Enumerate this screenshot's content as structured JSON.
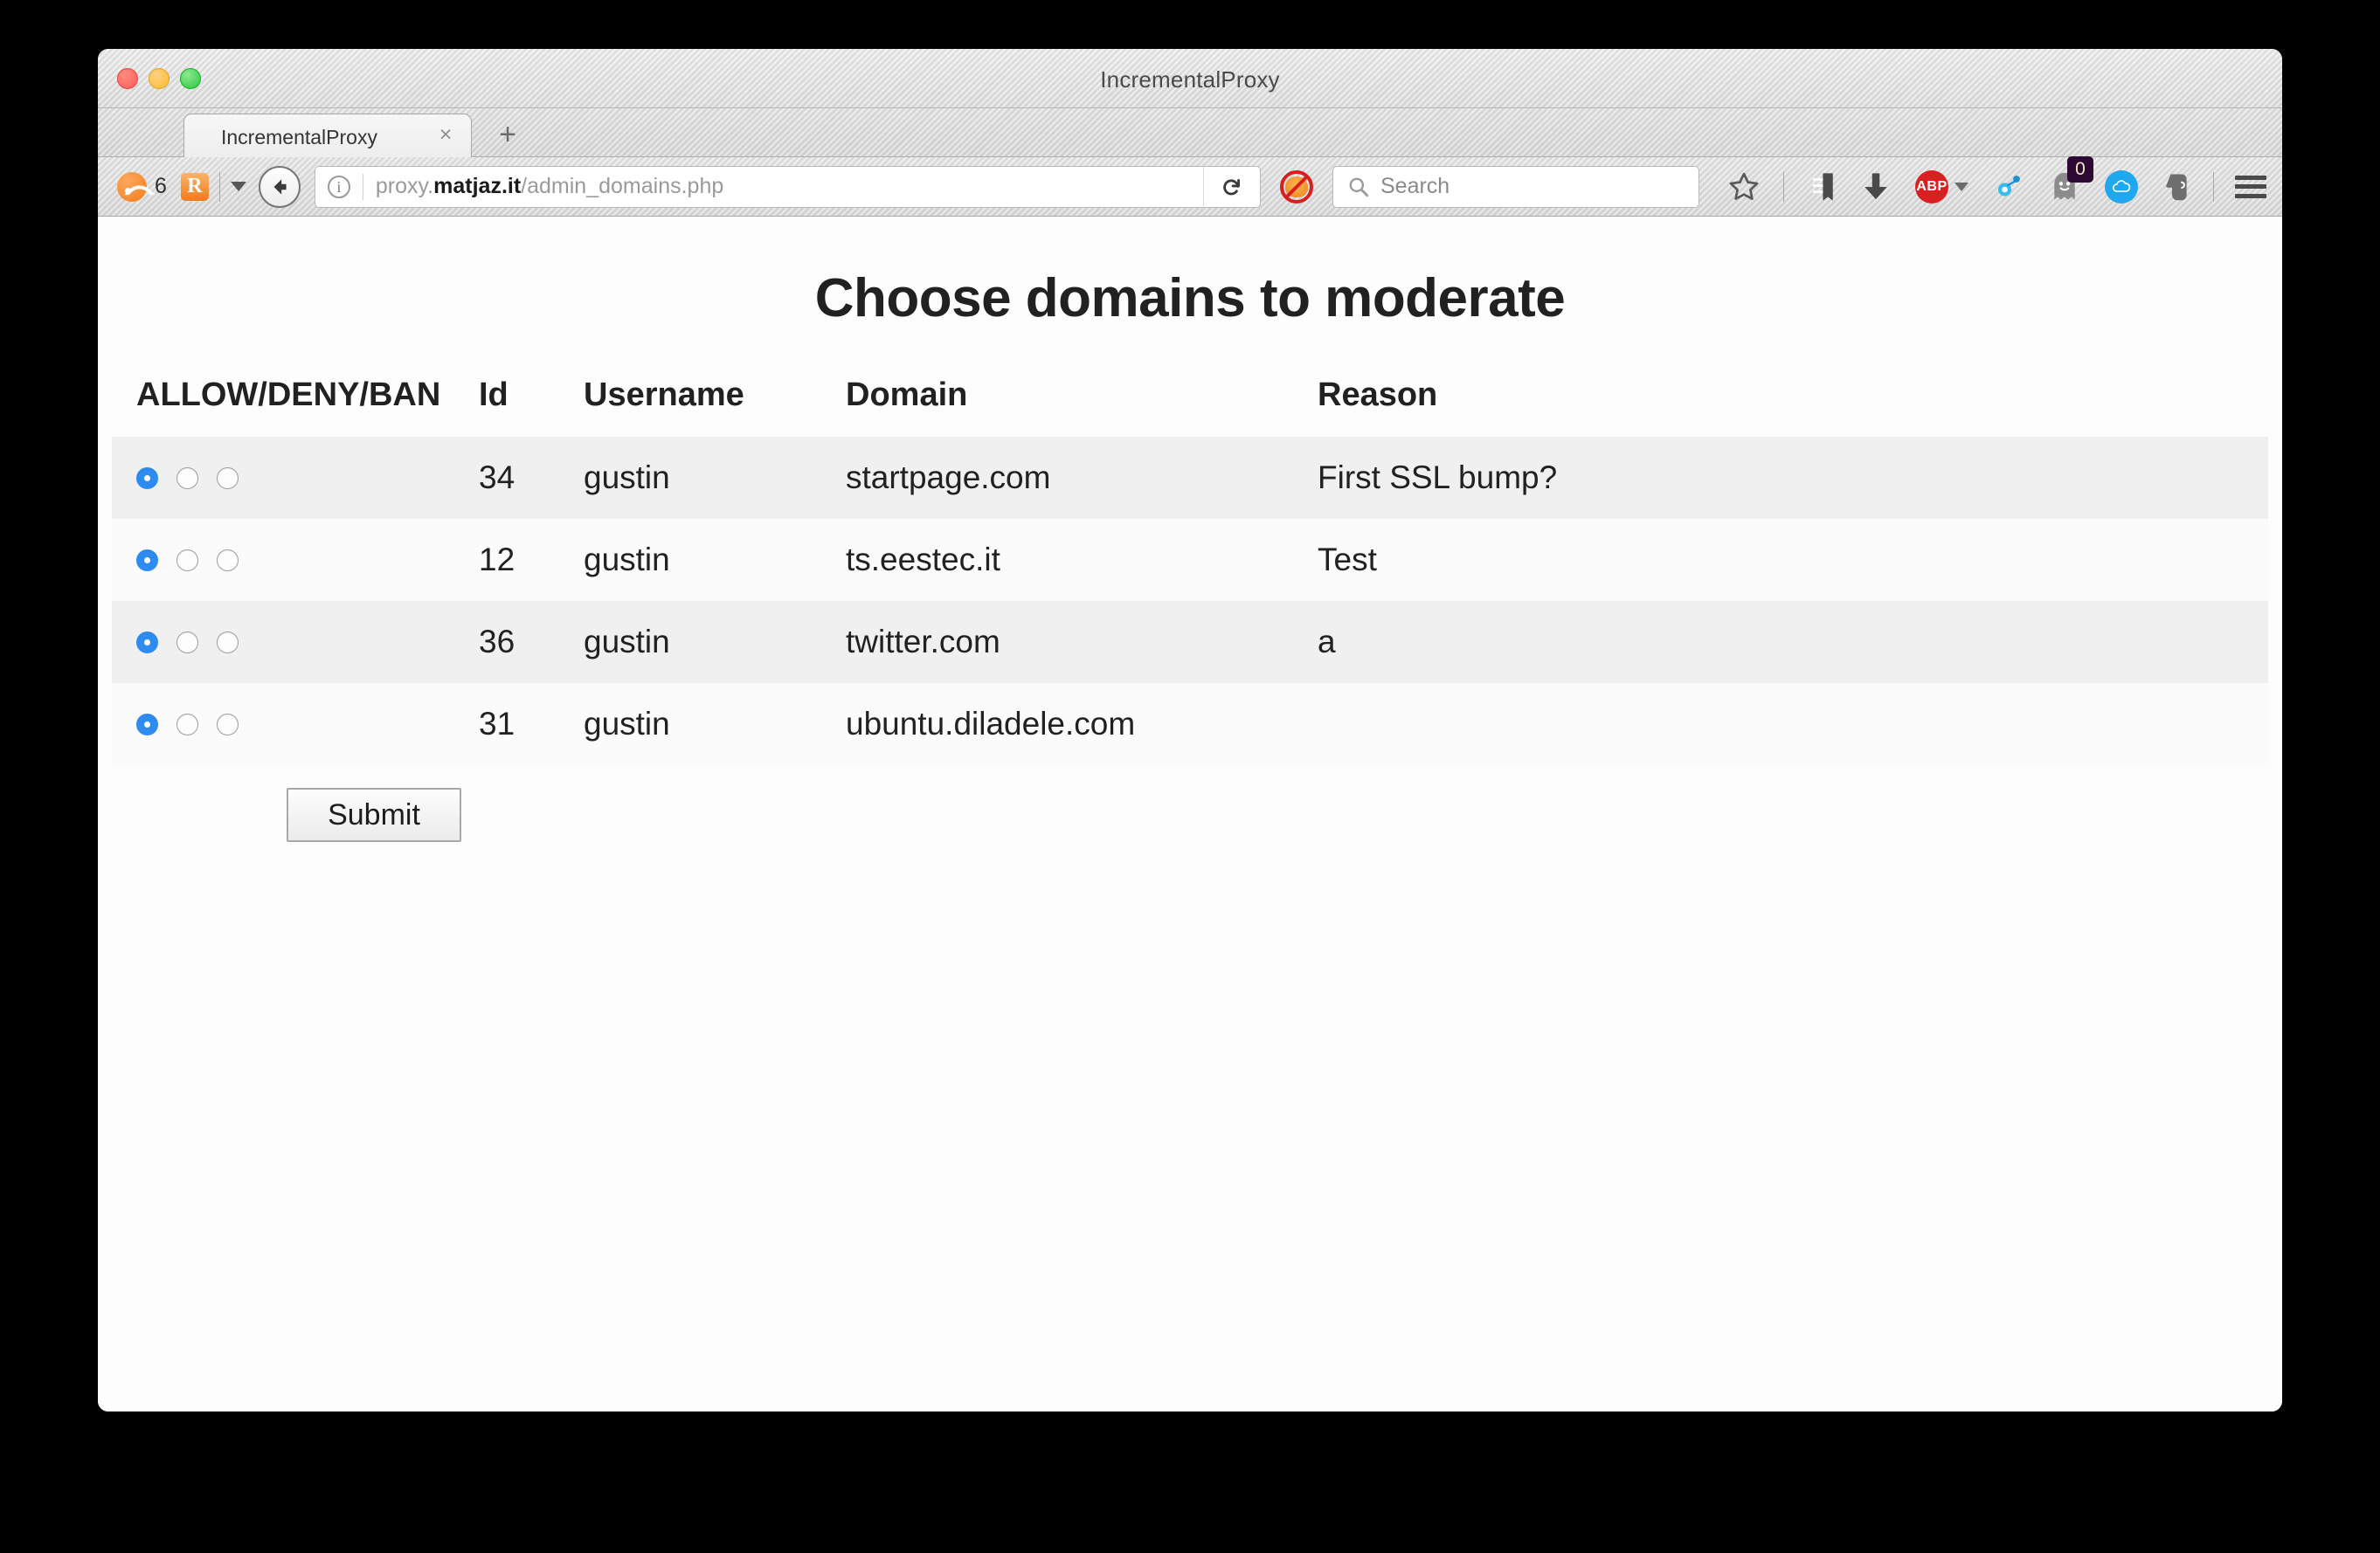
{
  "window": {
    "title": "IncrementalProxy"
  },
  "tabs": {
    "items": [
      {
        "label": "IncrementalProxy",
        "close_label": "×"
      }
    ],
    "new_tab_label": "+"
  },
  "toolbar": {
    "rss_count": "6",
    "reader_letter": "R",
    "url": {
      "prefix": "proxy.",
      "domain": "matjaz.it",
      "path": "/admin_domains.php",
      "full": "proxy.matjaz.it/admin_domains.php"
    },
    "search": {
      "placeholder": "Search",
      "value": ""
    },
    "abp_label": "ABP",
    "ghostery_badge": "0",
    "icons": [
      "rss-feed-icon",
      "reader-icon",
      "reader-dropdown-icon",
      "back-icon",
      "page-info-icon",
      "reload-icon",
      "noscript-blocked-icon",
      "search-icon",
      "bookmark-star-icon",
      "reading-list-icon",
      "downloads-icon",
      "adblock-plus-icon",
      "hubspot-icon",
      "ghostery-icon",
      "cloud-icon",
      "evernote-icon",
      "menu-hamburger-icon"
    ]
  },
  "page": {
    "heading": "Choose domains to moderate",
    "table": {
      "headers": [
        "ALLOW/DENY/BAN",
        "Id",
        "Username",
        "Domain",
        "Reason"
      ],
      "radio_options": [
        "ALLOW",
        "DENY",
        "BAN"
      ],
      "rows": [
        {
          "selected": 0,
          "id": "34",
          "username": "gustin",
          "domain": "startpage.com",
          "reason": "First SSL bump?"
        },
        {
          "selected": 0,
          "id": "12",
          "username": "gustin",
          "domain": "ts.eestec.it",
          "reason": "Test"
        },
        {
          "selected": 0,
          "id": "36",
          "username": "gustin",
          "domain": "twitter.com",
          "reason": "a"
        },
        {
          "selected": 0,
          "id": "31",
          "username": "gustin",
          "domain": "ubuntu.diladele.com",
          "reason": ""
        }
      ]
    },
    "submit_label": "Submit"
  },
  "colors": {
    "radio_selected": "#2e8cf0",
    "row_odd": "#f0f0f0",
    "row_even": "#fbfbfb",
    "text": "#212121",
    "abp_red": "#d91f1f",
    "rss_orange": "#f07c1e"
  }
}
